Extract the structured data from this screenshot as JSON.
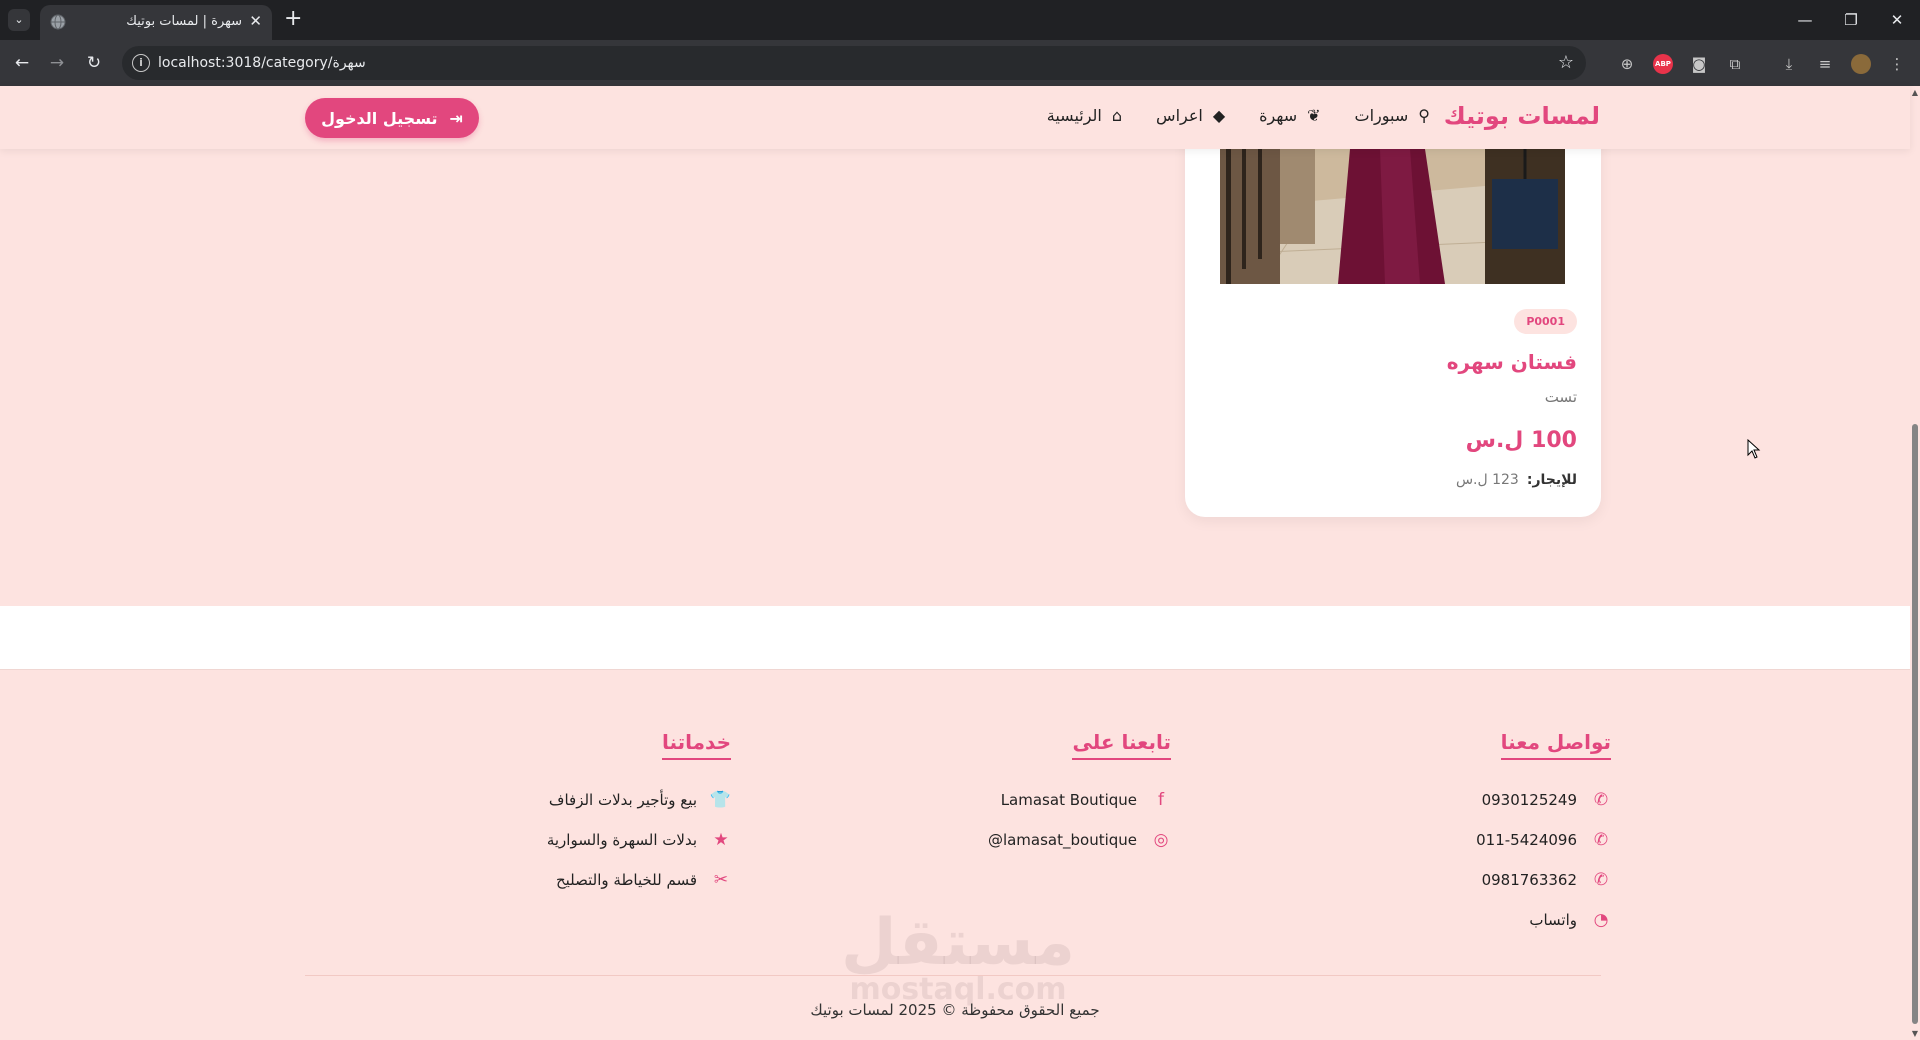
{
  "browser": {
    "tab_title": "سهرة | لمسات بوتيك",
    "url": "localhost:3018/category/سهرة",
    "tab_dropdown_glyph": "⌄",
    "close_glyph": "✕",
    "newtab_glyph": "+",
    "window_controls": [
      "—",
      "❐",
      "✕"
    ]
  },
  "header": {
    "brand": "لمسات بوتيك",
    "nav": [
      {
        "label": "الرئيسية",
        "icon": "home-icon",
        "glyph": "⌂"
      },
      {
        "label": "اعراس",
        "icon": "gem-icon",
        "glyph": "◆"
      },
      {
        "label": "سهرة",
        "icon": "feather-icon",
        "glyph": "❦"
      },
      {
        "label": "سبورات",
        "icon": "running-icon",
        "glyph": "⚲"
      }
    ],
    "login_label": "تسجيل الدخول",
    "login_icon": "sign-in-icon",
    "login_glyph": "⇥"
  },
  "product": {
    "code": "P0001",
    "name": "فستان سهره",
    "description": "تست",
    "price": "100 ل.س",
    "rent_label": "للإيجار:",
    "rent_value": "123 ل.س"
  },
  "footer": {
    "contact": {
      "heading": "تواصل معنا",
      "items": [
        {
          "text": "0930125249",
          "icon": "phone-icon",
          "glyph": "✆"
        },
        {
          "text": "011-5424096",
          "icon": "phone-icon",
          "glyph": "✆"
        },
        {
          "text": "0981763362",
          "icon": "phone-icon",
          "glyph": "✆"
        },
        {
          "text": "واتساب",
          "icon": "whatsapp-icon",
          "glyph": "◔"
        }
      ]
    },
    "follow": {
      "heading": "تابعنا على",
      "items": [
        {
          "text": "Lamasat Boutique",
          "icon": "facebook-icon",
          "glyph": "f"
        },
        {
          "text": "lamasat_boutique@",
          "icon": "instagram-icon",
          "glyph": "◎"
        }
      ]
    },
    "services": {
      "heading": "خدماتنا",
      "items": [
        {
          "text": "بيع وتأجير بدلات الزفاف",
          "icon": "shirt-icon",
          "glyph": "👕"
        },
        {
          "text": "بدلات السهرة والسوارية",
          "icon": "star-icon",
          "glyph": "★"
        },
        {
          "text": "قسم للخياطة والتصليح",
          "icon": "scissors-icon",
          "glyph": "✂"
        }
      ]
    },
    "copyright": "جميع الحقوق محفوظة © 2025 لمسات بوتيك",
    "watermark_ar": "مستقل",
    "watermark_en": "mostaql.com"
  },
  "colors": {
    "accent": "#e2477e",
    "page_bg": "#fde3e0",
    "chrome_dark": "#202124",
    "toolbar": "#35363a"
  }
}
